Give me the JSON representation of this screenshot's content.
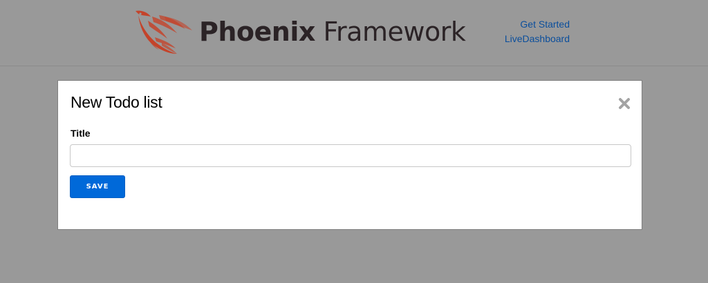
{
  "header": {
    "logo_text_bold": "Phoenix",
    "logo_text_light": "Framework",
    "nav": {
      "get_started": "Get Started",
      "live_dashboard": "LiveDashboard"
    }
  },
  "modal": {
    "title": "New Todo list",
    "close_icon": "close-icon",
    "form": {
      "title_label": "Title",
      "title_value": "",
      "save_label": "SAVE"
    }
  },
  "colors": {
    "backdrop": "#999999",
    "link": "#0a4e9c",
    "primary_button": "#0069d9",
    "logo_orange": "#c4432a",
    "logo_text": "#2b2326"
  }
}
